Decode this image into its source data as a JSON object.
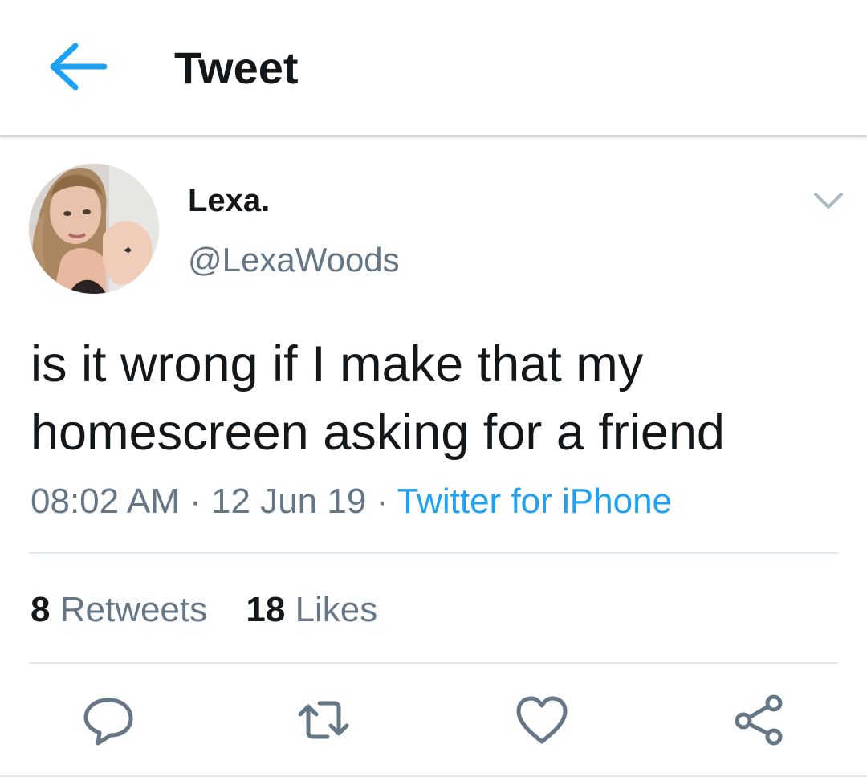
{
  "header": {
    "title": "Tweet",
    "back_icon": "arrow-left-icon"
  },
  "tweet": {
    "author": {
      "display_name": "Lexa.",
      "handle": "@LexaWoods",
      "avatar": "avatar-photo"
    },
    "menu_icon": "chevron-down-icon",
    "text": "is it wrong if I make that my homescreen asking for a friend",
    "time": "08:02 AM",
    "date": "12 Jun 19",
    "separator": "·",
    "source": "Twitter for iPhone",
    "stats": {
      "retweets_count": "8",
      "retweets_label": "Retweets",
      "likes_count": "18",
      "likes_label": "Likes"
    },
    "actions": [
      "reply-icon",
      "retweet-icon",
      "heart-icon",
      "share-icon"
    ]
  },
  "colors": {
    "accent": "#1da1f2",
    "text_primary": "#14171a",
    "text_secondary": "#657786",
    "divider": "#e1e8ed"
  }
}
